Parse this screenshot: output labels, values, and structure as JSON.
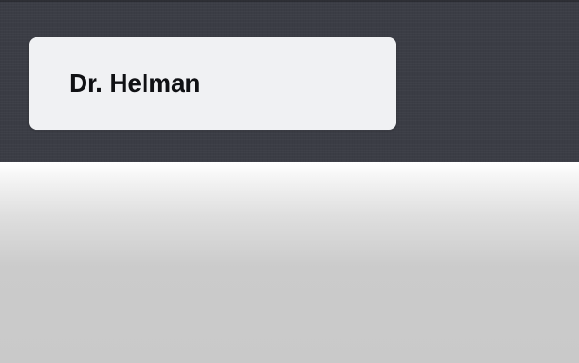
{
  "header": {
    "name_card": {
      "name": "Dr. Helman"
    }
  },
  "colors": {
    "header_background": "#3b3d45",
    "card_background": "#f0f1f3",
    "name_text": "#101114",
    "content_gradient_top": "#ffffff",
    "content_gradient_bottom": "#c9c9c9"
  }
}
